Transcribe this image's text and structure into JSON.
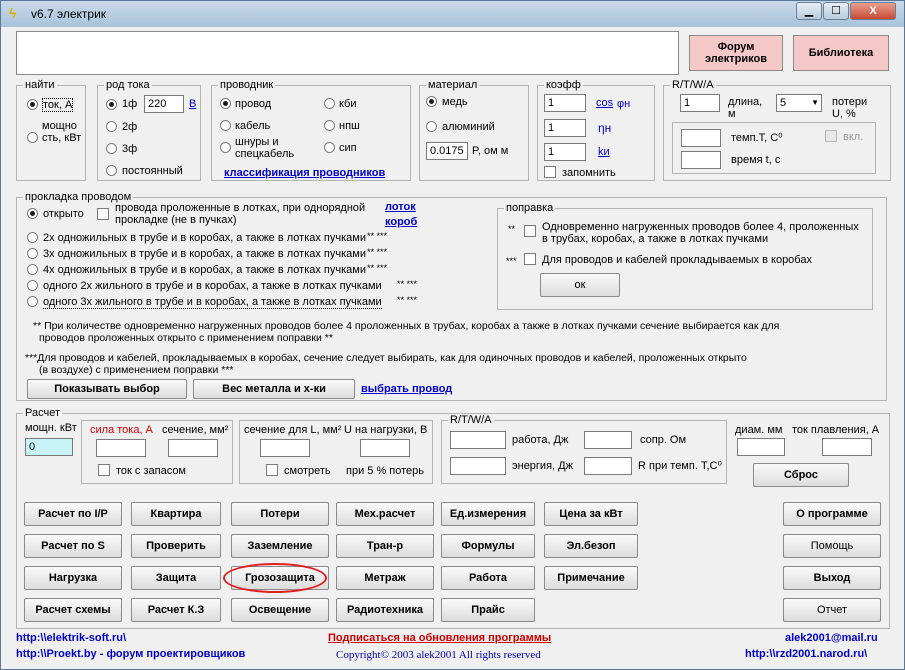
{
  "window": {
    "title": "v6.7 электрик",
    "min": "▁",
    "max": "☐",
    "close": "X"
  },
  "top": {
    "forum": "Форум электриков",
    "library": "Библиотека"
  },
  "find": {
    "title": "найти",
    "current": "ток, А",
    "power": "мощно сть, кВт"
  },
  "kind": {
    "title": "род тока",
    "ph1": "1ф",
    "voltage": "220",
    "unit": "В",
    "ph2": "2ф",
    "ph3": "3ф",
    "dc": "постоянный"
  },
  "conductor": {
    "title": "проводник",
    "wire": "провод",
    "cable": "кабель",
    "cords": "шнуры и спецкабель",
    "kbi": "кби",
    "nps": "нпш",
    "sip": "сип",
    "classify": "классификация проводников"
  },
  "material": {
    "title": "материал",
    "copper": "медь",
    "aluminum": "алюминий",
    "rho_value": "0.0175",
    "rho_label": "Ρ, ом м"
  },
  "coef": {
    "title": "коэфф",
    "v1": "1",
    "v2": "1",
    "v3": "1",
    "cos": "cos",
    "phi": "φн",
    "eta": "ηн",
    "k": "kи",
    "remember": "запомнить"
  },
  "rtwa": {
    "title": "R/T/W/A",
    "len_val": "1",
    "len_label": "длина, м",
    "loss_val": "5",
    "loss_label": "потери U, %",
    "temp": "темп.T, C⁰",
    "time": "время t, с",
    "on": "вкл."
  },
  "laying": {
    "title": "прокладка проводом",
    "open": "открыто",
    "tray": "провода проложенные в лотках, при однорядной прокладке (не в пучках)",
    "tray_link": "лоток",
    "box_link": "короб",
    "opt1": "2х одножильных в трубе и в коробах, а также в лотках пучками",
    "opt2": "3х одножильных в трубе и в коробах, а также в лотках пучками",
    "opt3": "4х одножильных в трубе и в коробах, а также в лотках пучками",
    "opt4": "одного 2х жильного в трубе и в коробах, а также в лотках пучками",
    "opt5": "одного 3х жильного в трубе и в коробах, а также в лотках пучками",
    "mark": "** ***"
  },
  "correction": {
    "title": "поправка",
    "m1": "**",
    "t1": "Одновременно нагруженных проводов более 4, проложенных в трубах, коробах, а также в лотках пучками",
    "m2": "***",
    "t2": "Для проводов и кабелей прокладываемых в коробах",
    "ok": "ок"
  },
  "notes": {
    "n1a": "** При количестве одновременно нагруженных проводов более 4 проложенных в трубах, коробах а также в лотках пучками сечение выбирается как для",
    "n1b": "проводов проложенных открыто с применением поправки **",
    "n2a": "***Для проводов и кабелей, прокладываемых в коробах, сечение следует выбирать, как для одиночных проводов и кабелей, проложенных открыто",
    "n2b": "(в воздухе) с применением поправки ***"
  },
  "actions": {
    "show": "Показывать выбор",
    "weight": "Вес металла и х-ки",
    "pick": "выбрать провод"
  },
  "calc": {
    "title": "Расчет",
    "power": "мощн. кВт",
    "power_val": "0",
    "current": "сила тока, А",
    "section": "сечение, мм²",
    "reserve": "ток с запасом",
    "sect_l": "сечение для L, мм²",
    "u_load": "U на нагрузки, В",
    "watch": "смотреть",
    "at5": "при 5 % потерь",
    "rtwa": "R/T/W/A",
    "work": "работа, Дж",
    "energy": "энергия, Дж",
    "res": "сопр. Ом",
    "res_t": "R при темп. T,C⁰",
    "diam": "диам. мм",
    "melt": "ток плавления, А",
    "reset": "Сброс"
  },
  "buttons": {
    "b1": "Расчет по I/P",
    "b2": "Квартира",
    "b3": "Потери",
    "b4": "Мех.расчет",
    "b5": "Ед.измерения",
    "b6": "Цена за кВт",
    "b7": "О программе",
    "c1": "Расчет по S",
    "c2": "Проверить",
    "c3": "Заземление",
    "c4": "Тран-р",
    "c5": "Формулы",
    "c6": "Эл.безоп",
    "c7": "Помощь",
    "d1": "Нагрузка",
    "d2": "Защита",
    "d3": "Грозозащита",
    "d4": "Метраж",
    "d5": "Работа",
    "d6": "Примечание",
    "d7": "Выход",
    "e1": "Расчет схемы",
    "e2": "Расчет К.З",
    "e3": "Освещение",
    "e4": "Радиотехника",
    "e5": "Прайс",
    "e7": "Отчет"
  },
  "footer": {
    "site": "http:\\\\elektrik-soft.ru\\",
    "subscribe": "Подписаться на обновления программы",
    "mail": "alek2001@mail.ru",
    "proekt": "http:\\\\Proekt.by - форум проектировщиков",
    "copy": "Copyright© 2003 alek2001 All rights reserved",
    "narod": "http:\\\\rzd2001.narod.ru\\"
  }
}
